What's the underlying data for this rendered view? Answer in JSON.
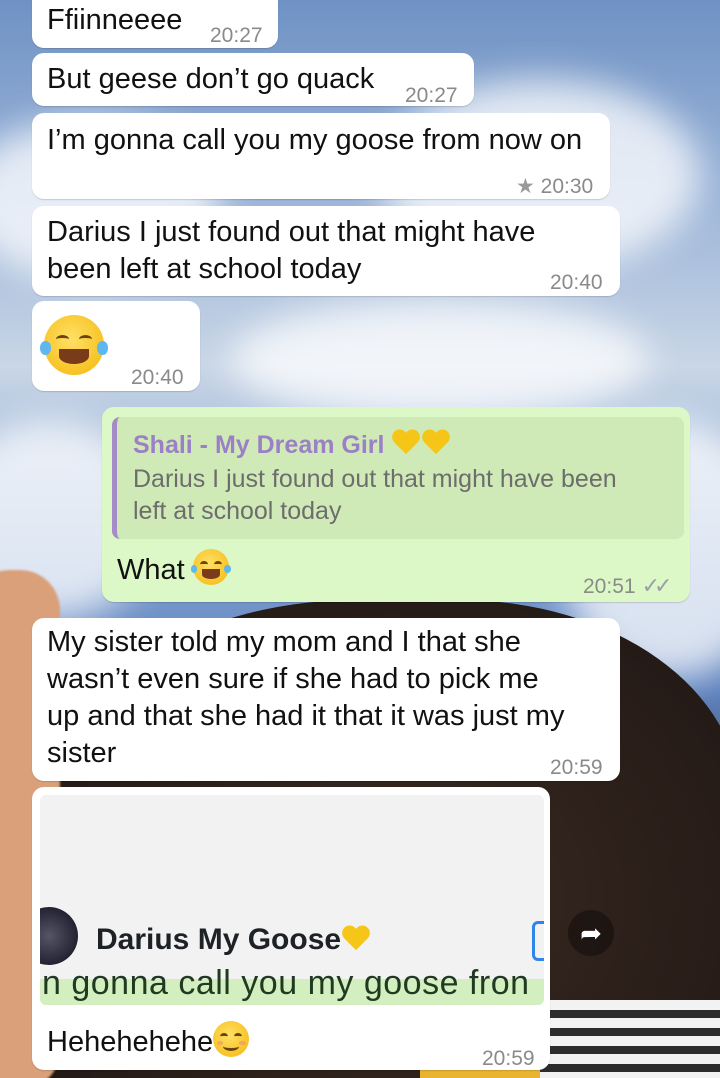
{
  "messages": [
    {
      "dir": "in",
      "text": "Ffiinneeee",
      "time": "20:27"
    },
    {
      "dir": "in",
      "text": "But geese don’t go quack",
      "time": "20:27"
    },
    {
      "dir": "in",
      "text": "I’m gonna call you my goose from now on",
      "time": "20:30",
      "starred": true
    },
    {
      "dir": "in",
      "lines": [
        "Darius I just found out that might have",
        "been left at school today"
      ],
      "time": "20:40"
    },
    {
      "dir": "in",
      "emoji": "face-with-tears-of-joy",
      "time": "20:40"
    },
    {
      "dir": "out",
      "reply": {
        "name": "Shali - My Dream Girl",
        "name_emoji": "yellow-heart x2",
        "lines": [
          "Darius I just found out that might have been",
          "left at school today"
        ]
      },
      "text": "What",
      "emoji": "face-with-tears-of-joy",
      "time": "20:51",
      "status": "read"
    },
    {
      "dir": "in",
      "lines": [
        "My sister told my mom and I that she",
        "wasn’t even sure if she had to pick me",
        "up and that she had it that it was just my",
        "sister"
      ],
      "time": "20:59"
    },
    {
      "dir": "in",
      "image": {
        "contact_name": "Darius My Goose",
        "contact_emoji": "yellow-heart",
        "cut_text": "n gonna call you my goose fron"
      },
      "text": "Hehehehehe",
      "emoji": "smiling-face-with-smiling-eyes",
      "time": "20:59"
    }
  ],
  "icons": {
    "star": "star-icon",
    "ticks": "double-check-icon",
    "forward": "forward-icon"
  },
  "colors": {
    "incoming": "#ffffff",
    "outgoing": "#dcf8c6",
    "quote_name": "#9b7fc7",
    "quote_bar": "#a58cc8"
  }
}
